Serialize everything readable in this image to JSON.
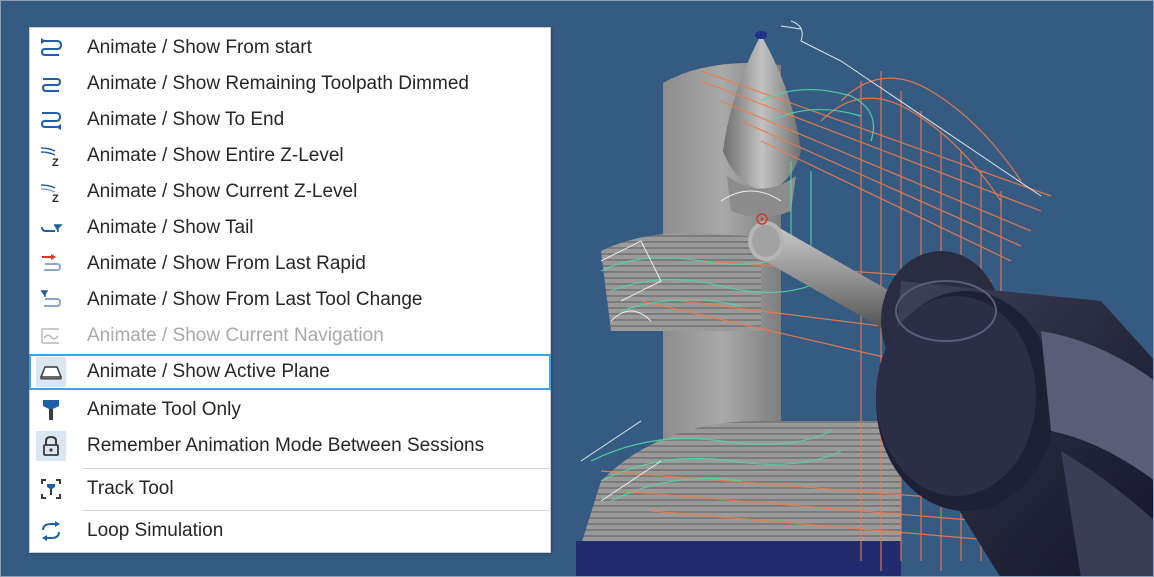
{
  "menu": {
    "items": [
      {
        "label": "Animate / Show From start",
        "icon": "toolpath-from-start-icon",
        "enabled": true
      },
      {
        "label": "Animate / Show Remaining Toolpath Dimmed",
        "icon": "toolpath-dimmed-icon",
        "enabled": true
      },
      {
        "label": "Animate / Show To End",
        "icon": "toolpath-to-end-icon",
        "enabled": true
      },
      {
        "label": "Animate / Show Entire Z-Level",
        "icon": "z-level-entire-icon",
        "enabled": true
      },
      {
        "label": "Animate / Show Current Z-Level",
        "icon": "z-level-current-icon",
        "enabled": true
      },
      {
        "label": "Animate / Show Tail",
        "icon": "tail-icon",
        "enabled": true
      },
      {
        "label": "Animate / Show From Last Rapid",
        "icon": "last-rapid-icon",
        "enabled": true
      },
      {
        "label": "Animate / Show From Last Tool Change",
        "icon": "last-tool-change-icon",
        "enabled": true
      },
      {
        "label": "Animate / Show Current Navigation",
        "icon": "navigation-icon",
        "enabled": false
      },
      {
        "label": "Animate / Show Active Plane",
        "icon": "active-plane-icon",
        "enabled": true,
        "highlighted": true
      },
      {
        "label": "Animate Tool Only",
        "icon": "tool-icon",
        "enabled": true
      },
      {
        "label": "Remember Animation Mode Between Sessions",
        "icon": "lock-icon",
        "enabled": true,
        "checked": true
      }
    ],
    "extra_items": [
      {
        "label": "Track Tool",
        "icon": "track-tool-icon",
        "enabled": true
      },
      {
        "label": "Loop Simulation",
        "icon": "loop-icon",
        "enabled": true
      }
    ]
  },
  "colors": {
    "viewport_bg": "#365b82",
    "highlight_border": "#3ea3ea",
    "toolpath_orange": "#f07a4a",
    "toolpath_teal": "#52d6a8",
    "icon_blue": "#1f5fa8",
    "rapid_red": "#d33a2c"
  }
}
